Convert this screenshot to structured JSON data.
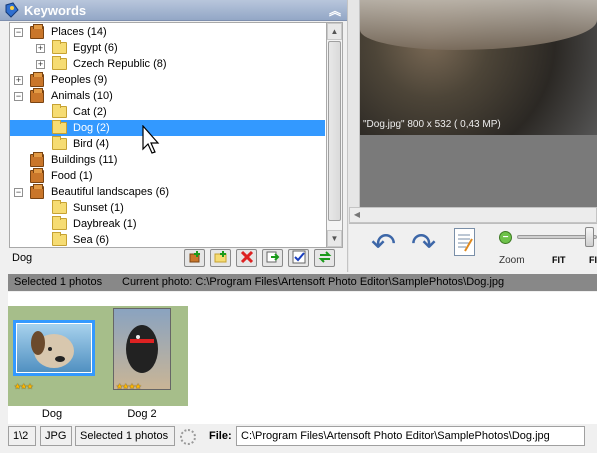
{
  "keywords_panel": {
    "title": "Keywords",
    "collapse_glyph": "«",
    "tree": [
      {
        "label": "Places (14)",
        "level": 0,
        "expander": "−",
        "icon": "box"
      },
      {
        "label": "Egypt  (6)",
        "level": 1,
        "expander": "+",
        "icon": "folder"
      },
      {
        "label": "Czech Republic  (8)",
        "level": 1,
        "expander": "+",
        "icon": "folder"
      },
      {
        "label": "Peoples (9)",
        "level": 0,
        "expander": "+",
        "icon": "box"
      },
      {
        "label": "Animals  (10)",
        "level": 0,
        "expander": "−",
        "icon": "box"
      },
      {
        "label": "Cat  (2)",
        "level": 1,
        "expander": "",
        "icon": "folder"
      },
      {
        "label": "Dog  (2)",
        "level": 1,
        "expander": "",
        "icon": "folder",
        "selected": true
      },
      {
        "label": "Bird  (4)",
        "level": 1,
        "expander": "",
        "icon": "folder"
      },
      {
        "label": "Buildings (11)",
        "level": 0,
        "expander": "",
        "icon": "box"
      },
      {
        "label": "Food  (1)",
        "level": 0,
        "expander": "",
        "icon": "box"
      },
      {
        "label": "Beautiful landscapes  (6)",
        "level": 0,
        "expander": "−",
        "icon": "box"
      },
      {
        "label": "Sunset  (1)",
        "level": 1,
        "expander": "",
        "icon": "folder"
      },
      {
        "label": "Daybreak  (1)",
        "level": 1,
        "expander": "",
        "icon": "folder"
      },
      {
        "label": "Sea  (6)",
        "level": 1,
        "expander": "",
        "icon": "folder"
      }
    ],
    "footer_word": "Dog",
    "footer_buttons": [
      "add-keyword",
      "add-folder",
      "delete",
      "export",
      "apply",
      "refresh"
    ]
  },
  "preview": {
    "info": "\"Dog.jpg\" 800 x 532 ( 0,43 MP)",
    "zoom_label": "Zoom",
    "fit_label": "FIT",
    "fit_label_2": "FI"
  },
  "status_bar": {
    "selected": "Selected 1 photos",
    "current_photo": "Current photo: C:\\Program Files\\Artensoft Photo Editor\\SamplePhotos\\Dog.jpg"
  },
  "thumbnails": [
    {
      "caption": "Dog",
      "stars": "★★★",
      "selected": true
    },
    {
      "caption": "Dog 2",
      "stars": "★★★★",
      "selected": false
    }
  ],
  "bottom_status": {
    "page": "1\\2",
    "format": "JPG",
    "selected": "Selected 1 photos",
    "file_label": "File:",
    "file_path": "C:\\Program Files\\Artensoft Photo Editor\\SamplePhotos\\Dog.jpg"
  },
  "colors": {
    "selection": "#3399ff",
    "header": "#93a7c6",
    "thumb_bg": "#a6be8a"
  }
}
